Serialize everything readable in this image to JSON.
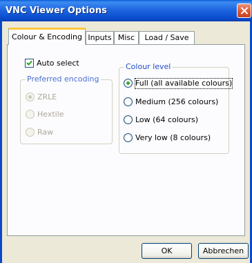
{
  "window": {
    "title": "VNC Viewer Options",
    "close_icon": "close-icon"
  },
  "tabs": [
    {
      "label": "Colour & Encoding",
      "active": true
    },
    {
      "label": "Inputs",
      "active": false
    },
    {
      "label": "Misc",
      "active": false
    },
    {
      "label": "Load / Save",
      "active": false
    }
  ],
  "auto_select": {
    "label": "Auto select",
    "checked": true
  },
  "preferred_encoding": {
    "title": "Preferred encoding",
    "options": [
      {
        "label": "ZRLE",
        "checked": true,
        "enabled": false
      },
      {
        "label": "Hextile",
        "checked": false,
        "enabled": false
      },
      {
        "label": "Raw",
        "checked": false,
        "enabled": false
      }
    ]
  },
  "colour_level": {
    "title": "Colour level",
    "options": [
      {
        "label": "Full (all available colours)",
        "checked": true,
        "enabled": true
      },
      {
        "label": "Medium (256 colours)",
        "checked": false,
        "enabled": true
      },
      {
        "label": "Low (64 colours)",
        "checked": false,
        "enabled": true
      },
      {
        "label": "Very low (8 colours)",
        "checked": false,
        "enabled": true
      }
    ]
  },
  "buttons": {
    "ok": "OK",
    "cancel": "Abbrechen"
  },
  "colors": {
    "titlebar": "#0A5FD8",
    "dialog_bg": "#ECE9D8",
    "tab_highlight": "#FFC83C",
    "radio_dot": "#39A72C"
  }
}
